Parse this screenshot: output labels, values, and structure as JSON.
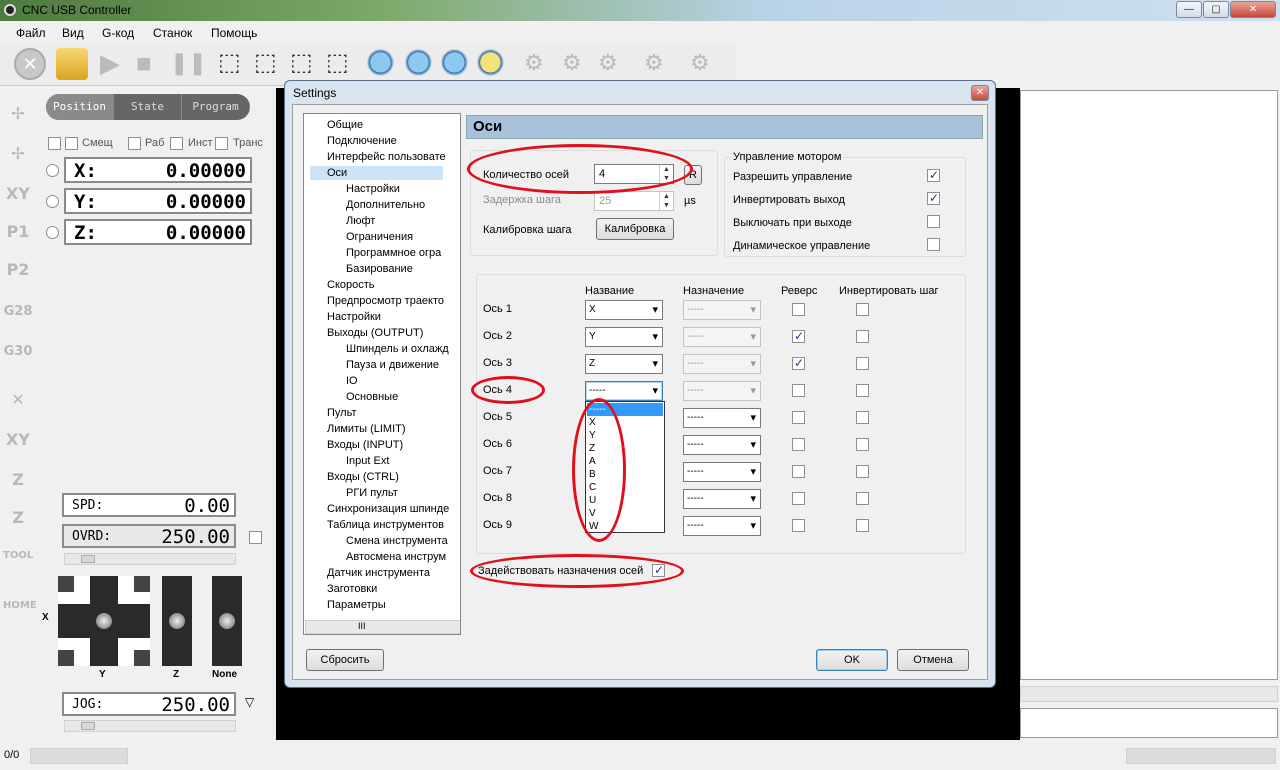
{
  "window": {
    "title": "CNC USB Controller",
    "minimize": "—",
    "maximize": "▢",
    "close": "✕"
  },
  "menu": [
    "Файл",
    "Вид",
    "G-код",
    "Станок",
    "Помощь"
  ],
  "mode_tabs": [
    "Position",
    "State",
    "Program"
  ],
  "coord_options": [
    "Смещ",
    "Раб",
    "Инст",
    "Транс"
  ],
  "coords": [
    {
      "label": "X:",
      "value": "0.00000"
    },
    {
      "label": "Y:",
      "value": "0.00000"
    },
    {
      "label": "Z:",
      "value": "0.00000"
    }
  ],
  "side_icons": [
    "XY",
    "P1",
    "P2",
    "G28",
    "G30",
    "XY",
    "Z",
    "Z",
    "TOOL",
    "HOME"
  ],
  "spd": {
    "label": "SPD:",
    "value": "0.00"
  },
  "ovrd": {
    "label": "OVRD:",
    "value": "250.00"
  },
  "jog": {
    "label": "JOG:",
    "value": "250.00"
  },
  "jog_axes": {
    "x": "X",
    "y": "Y",
    "z": "Z",
    "none": "None"
  },
  "status": {
    "counter": "0/0"
  },
  "dialog": {
    "title": "Settings",
    "close": "✕",
    "tree": [
      {
        "label": "Общие",
        "level": 0
      },
      {
        "label": "Подключение",
        "level": 0
      },
      {
        "label": "Интерфейс пользовате",
        "level": 0
      },
      {
        "label": "Оси",
        "level": 0,
        "selected": true
      },
      {
        "label": "Настройки",
        "level": 1
      },
      {
        "label": "Дополнительно",
        "level": 1
      },
      {
        "label": "Люфт",
        "level": 1
      },
      {
        "label": "Ограничения",
        "level": 1
      },
      {
        "label": "Программное огра",
        "level": 1
      },
      {
        "label": "Базирование",
        "level": 1
      },
      {
        "label": "Скорость",
        "level": 0
      },
      {
        "label": "Предпросмотр траекто",
        "level": 0
      },
      {
        "label": "Настройки",
        "level": 0
      },
      {
        "label": "Выходы (OUTPUT)",
        "level": 0
      },
      {
        "label": "Шпиндель и охлажд",
        "level": 1
      },
      {
        "label": "Пауза и движение",
        "level": 1
      },
      {
        "label": "IO",
        "level": 1
      },
      {
        "label": "Основные",
        "level": 1
      },
      {
        "label": "Пульт",
        "level": 0
      },
      {
        "label": "Лимиты (LIMIT)",
        "level": 0
      },
      {
        "label": "Входы (INPUT)",
        "level": 0
      },
      {
        "label": "Input Ext",
        "level": 1
      },
      {
        "label": "Входы (CTRL)",
        "level": 0
      },
      {
        "label": "РГИ пульт",
        "level": 1
      },
      {
        "label": "Синхронизация шпинде",
        "level": 0
      },
      {
        "label": "Таблица инструментов",
        "level": 0
      },
      {
        "label": "Смена инструмента",
        "level": 1
      },
      {
        "label": "Автосмена инструм",
        "level": 1
      },
      {
        "label": "Датчик инструмента",
        "level": 0
      },
      {
        "label": "Заготовки",
        "level": 0
      },
      {
        "label": "Параметры",
        "level": 0
      }
    ],
    "tree_hscroll": "III",
    "header": "Оси",
    "axis_count_label": "Количество осей",
    "axis_count_value": "4",
    "step_delay_label": "Задержка шага",
    "step_delay_value": "25",
    "step_delay_unit": "µs",
    "calibration_label": "Калибровка шага",
    "calibration_button": "Калибровка",
    "motor_group_title": "Управление мотором",
    "motor_options": [
      {
        "label": "Разрешить управление",
        "checked": true
      },
      {
        "label": "Инвертировать выход",
        "checked": true
      },
      {
        "label": "Выключать при выходе",
        "checked": false
      },
      {
        "label": "Динамическое управление",
        "checked": false
      }
    ],
    "table_headers": {
      "name": "Название",
      "assign": "Назначение",
      "reverse": "Реверс",
      "invert": "Инвертировать шаг"
    },
    "axes": [
      {
        "label": "Ось 1",
        "name": "X",
        "assign": "-----",
        "reverse": false,
        "invert": false,
        "enabled": true
      },
      {
        "label": "Ось 2",
        "name": "Y",
        "assign": "-----",
        "reverse": true,
        "invert": false,
        "enabled": true
      },
      {
        "label": "Ось 3",
        "name": "Z",
        "assign": "-----",
        "reverse": true,
        "invert": false,
        "enabled": true
      },
      {
        "label": "Ось 4",
        "name": "-----",
        "assign": "-----",
        "reverse": false,
        "invert": false,
        "enabled": true
      },
      {
        "label": "Ось 5",
        "name": "",
        "assign": "-----",
        "reverse": false,
        "invert": false,
        "enabled": false
      },
      {
        "label": "Ось 6",
        "name": "",
        "assign": "-----",
        "reverse": false,
        "invert": false,
        "enabled": false
      },
      {
        "label": "Ось 7",
        "name": "",
        "assign": "-----",
        "reverse": false,
        "invert": false,
        "enabled": false
      },
      {
        "label": "Ось 8",
        "name": "",
        "assign": "-----",
        "reverse": false,
        "invert": false,
        "enabled": false
      },
      {
        "label": "Ось 9",
        "name": "",
        "assign": "-----",
        "reverse": false,
        "invert": false,
        "enabled": false
      }
    ],
    "dropdown_options": [
      "-----",
      "X",
      "Y",
      "Z",
      "A",
      "B",
      "C",
      "U",
      "V",
      "W"
    ],
    "use_assign_label": "Задействовать назначения осей",
    "reset_button": "Сбросить",
    "ok_button": "OK",
    "cancel_button": "Отмена"
  },
  "colors": {
    "accent": "#3399ff",
    "header": "#a8c2dc",
    "annotation": "#e0101c"
  }
}
